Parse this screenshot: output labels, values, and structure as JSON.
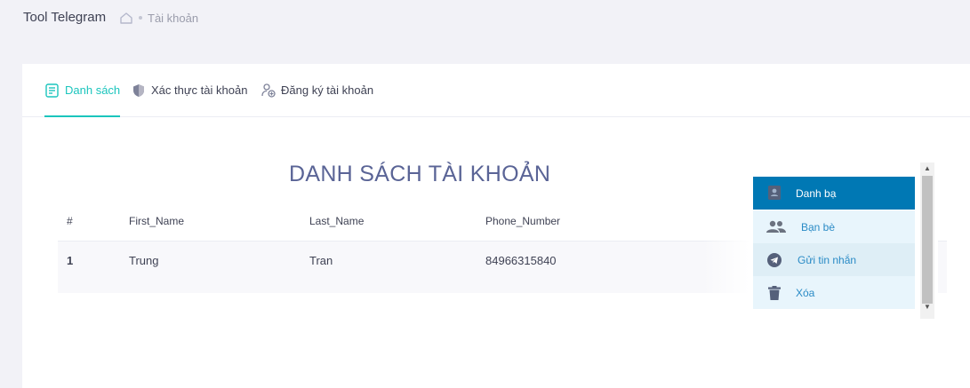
{
  "app": {
    "title": "Tool Telegram"
  },
  "breadcrumb": {
    "current": "Tài khoản"
  },
  "tabs": [
    {
      "label": "Danh sách",
      "icon": "list-icon",
      "active": true
    },
    {
      "label": "Xác thực tài khoản",
      "icon": "shield-icon",
      "active": false
    },
    {
      "label": "Đăng ký tài khoản",
      "icon": "user-add-icon",
      "active": false
    }
  ],
  "list": {
    "title": "DANH SÁCH TÀI KHOẢN",
    "columns": [
      "#",
      "First_Name",
      "Last_Name",
      "Phone_Number"
    ],
    "rows": [
      {
        "index": "1",
        "first_name": "Trung",
        "last_name": "Tran",
        "phone": "84966315840"
      }
    ]
  },
  "context_menu": {
    "items": [
      {
        "label": "Danh bạ",
        "icon": "contact-book-icon",
        "state": "active"
      },
      {
        "label": "Bạn bè",
        "icon": "friends-icon",
        "state": "normal"
      },
      {
        "label": "Gửi tin nhắn",
        "icon": "telegram-icon",
        "state": "hover"
      },
      {
        "label": "Xóa",
        "icon": "trash-icon",
        "state": "normal"
      }
    ]
  },
  "colors": {
    "accent": "#1bc5bd",
    "menu_active": "#0078b4",
    "menu_bg": "#e8f5fc",
    "menu_hover": "#deeef6",
    "title": "#5a6496"
  }
}
